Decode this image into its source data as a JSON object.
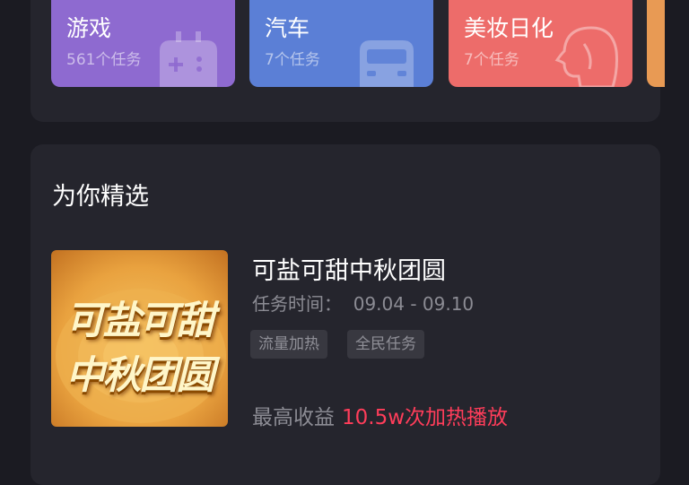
{
  "categories": [
    {
      "name": "游戏",
      "count": "561个任务",
      "icon": "gamepad-icon",
      "color": "#8e6ad0"
    },
    {
      "name": "汽车",
      "count": "7个任务",
      "icon": "car-icon",
      "color": "#5b7fd6"
    },
    {
      "name": "美妆日化",
      "count": "7个任务",
      "icon": "face-icon",
      "color": "#ed6c6a"
    }
  ],
  "featured": {
    "title": "为你精选",
    "task": {
      "thumbnail_line1": "可盐可甜",
      "thumbnail_line2": "中秋团圆",
      "name": "可盐可甜中秋团圆",
      "time": "任务时间：  09.04 - 09.10",
      "tags": [
        "流量加热",
        "全民任务"
      ],
      "reward_label": "最高收益",
      "reward_value": "10.5w次加热播放"
    }
  }
}
